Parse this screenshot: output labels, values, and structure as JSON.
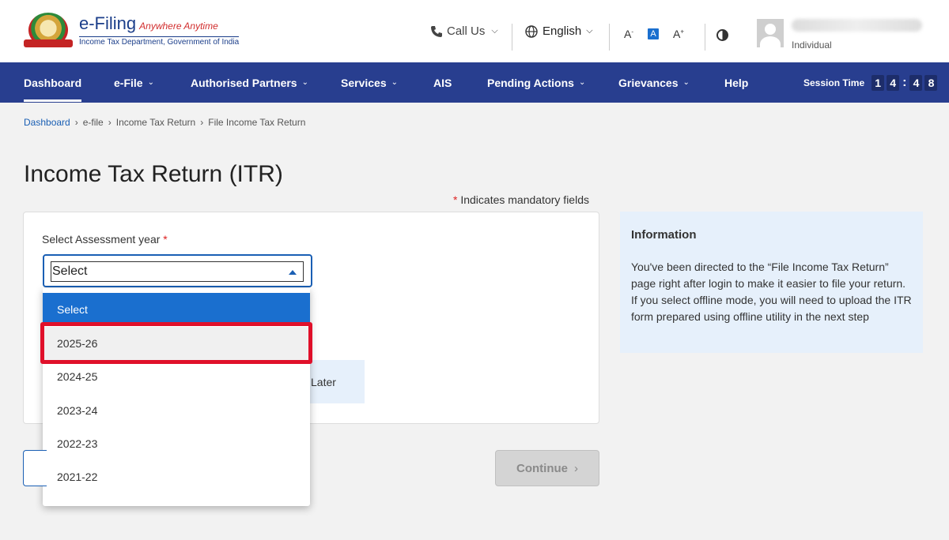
{
  "header": {
    "brand_title": "e-Filing",
    "brand_tagline": "Anywhere Anytime",
    "brand_subtitle": "Income Tax Department, Government of India",
    "call_us": "Call Us",
    "language": "English",
    "font_decrease": "A",
    "font_normal": "A",
    "font_increase": "A",
    "user_role": "Individual"
  },
  "nav": {
    "items": [
      {
        "label": "Dashboard"
      },
      {
        "label": "e-File"
      },
      {
        "label": "Authorised Partners"
      },
      {
        "label": "Services"
      },
      {
        "label": "AIS"
      },
      {
        "label": "Pending Actions"
      },
      {
        "label": "Grievances"
      },
      {
        "label": "Help"
      }
    ],
    "session_label": "Session Time",
    "session_digits": [
      "1",
      "4",
      "4",
      "8"
    ]
  },
  "breadcrumb": [
    "Dashboard",
    "e-file",
    "Income Tax Return",
    "File Income Tax Return"
  ],
  "page": {
    "title": "Income Tax Return (ITR)",
    "mandatory_note": "Indicates mandatory fields",
    "field_label": "Select Assessment year",
    "select_value": "Select",
    "hidden_text": "Later",
    "continue_label": "Continue"
  },
  "dropdown": {
    "options": [
      "Select",
      "2025-26",
      "2024-25",
      "2023-24",
      "2022-23",
      "2021-22"
    ],
    "selected": "Select",
    "highlighted": "2025-26"
  },
  "info": {
    "title": "Information",
    "line1": "You've been directed to the “File Income Tax Return” page right after login to make it easier to file your return.",
    "line2": "If you select offline mode, you will need to upload the ITR form prepared using offline utility in the next step"
  },
  "colors": {
    "nav_bg": "#283e8f",
    "accent": "#1a6fcf",
    "highlight_border": "#e0102a"
  }
}
